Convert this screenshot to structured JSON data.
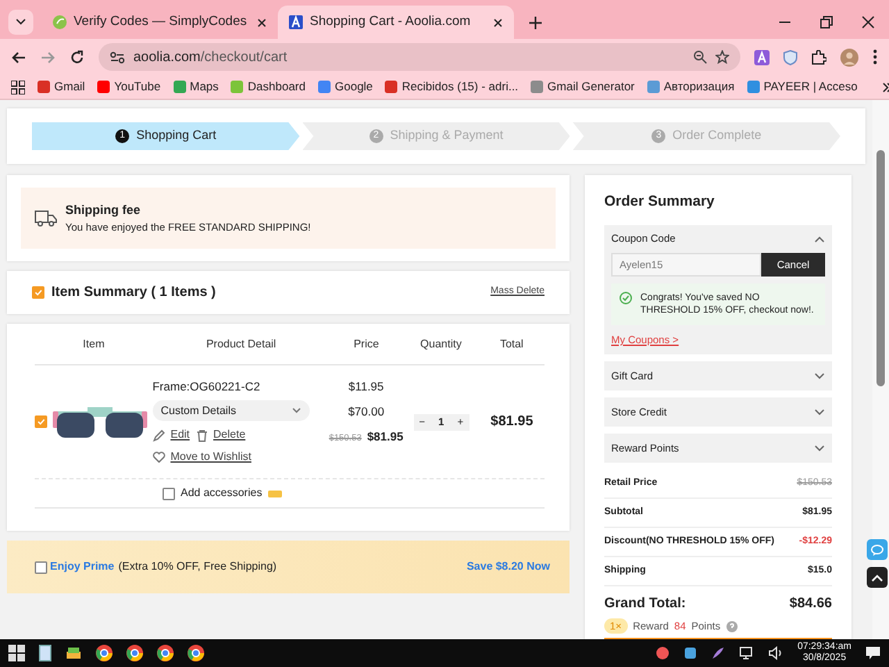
{
  "browser": {
    "tabs": [
      {
        "title": "Verify Codes — SimplyCodes",
        "selected": false
      },
      {
        "title": "Shopping Cart - Aoolia.com",
        "selected": true
      }
    ],
    "url_host": "aoolia.com",
    "url_path": "/checkout/cart",
    "bookmarks": [
      {
        "label": "Gmail",
        "color": "#d93025"
      },
      {
        "label": "YouTube",
        "color": "#ff0000"
      },
      {
        "label": "Maps",
        "color": "#34a853"
      },
      {
        "label": "Dashboard",
        "color": "#7cc43a"
      },
      {
        "label": "Google",
        "color": "#4285f4"
      },
      {
        "label": "Recibidos (15) - adri...",
        "color": "#d93025"
      },
      {
        "label": "Gmail Generator",
        "color": "#8c8c8c"
      },
      {
        "label": "Авторизация",
        "color": "#5b9bd5"
      },
      {
        "label": "PAYEER | Acceso",
        "color": "#2f8fe0"
      }
    ]
  },
  "steps": [
    {
      "number": "1",
      "label": "Shopping Cart",
      "selected": true
    },
    {
      "number": "2",
      "label": "Shipping & Payment",
      "selected": false
    },
    {
      "number": "3",
      "label": "Order Complete",
      "selected": false
    }
  ],
  "shipping_notice": {
    "title": "Shipping fee",
    "text": "You have enjoyed the FREE STANDARD SHIPPING!"
  },
  "item_summary": {
    "title": "Item Summary ( 1 Items )",
    "checked": true,
    "mass_delete": "Mass Delete"
  },
  "cart_table": {
    "columns": [
      "Item",
      "Product Detail",
      "Price",
      "Quantity",
      "Total"
    ],
    "items": [
      {
        "checked": true,
        "frame": "Frame:OG60221-C2",
        "custom_details": "Custom Details",
        "price_lines": [
          "$11.95",
          "$70.00"
        ],
        "original_price": "$150.53",
        "price": "$81.95",
        "decrease": "−",
        "quantity": "1",
        "increase": "+",
        "total": "$81.95",
        "edit": "Edit",
        "delete": "Delete",
        "wishlist": "Move to Wishlist"
      }
    ],
    "accessories": {
      "label": "Add accessories",
      "checked": false
    }
  },
  "prime": {
    "checked": false,
    "label": "Enjoy Prime",
    "detail": "(Extra 10% OFF, Free Shipping)",
    "action": "Save $8.20 Now"
  },
  "order_summary": {
    "title": "Order Summary",
    "coupon": {
      "label": "Coupon Code",
      "expanded": true,
      "value": "Ayelen15",
      "button": "Cancel",
      "message": "Congrats! You've saved NO THRESHOLD 15% OFF, checkout now!.",
      "link": "My Coupons >"
    },
    "sections": [
      {
        "label": "Gift Card",
        "expanded": false
      },
      {
        "label": "Store Credit",
        "expanded": false
      },
      {
        "label": "Reward Points",
        "expanded": false
      }
    ],
    "rows": [
      {
        "label": "Retail Price",
        "value": "$150.53",
        "kind": "strike"
      },
      {
        "label": "Subtotal",
        "value": "$81.95",
        "kind": "normal"
      },
      {
        "label": "Discount(NO THRESHOLD 15% OFF)",
        "value": "-$12.29",
        "kind": "discount"
      },
      {
        "label": "Shipping",
        "value": "$15.0",
        "kind": "normal"
      }
    ],
    "grand_total": {
      "label": "Grand Total:",
      "value": "$84.66"
    },
    "reward": {
      "badge": "1×",
      "label": "Reward",
      "points": "84",
      "unit": "Points"
    }
  },
  "taskbar": {
    "time": "07:29:34:am",
    "date": "30/8/2025"
  }
}
